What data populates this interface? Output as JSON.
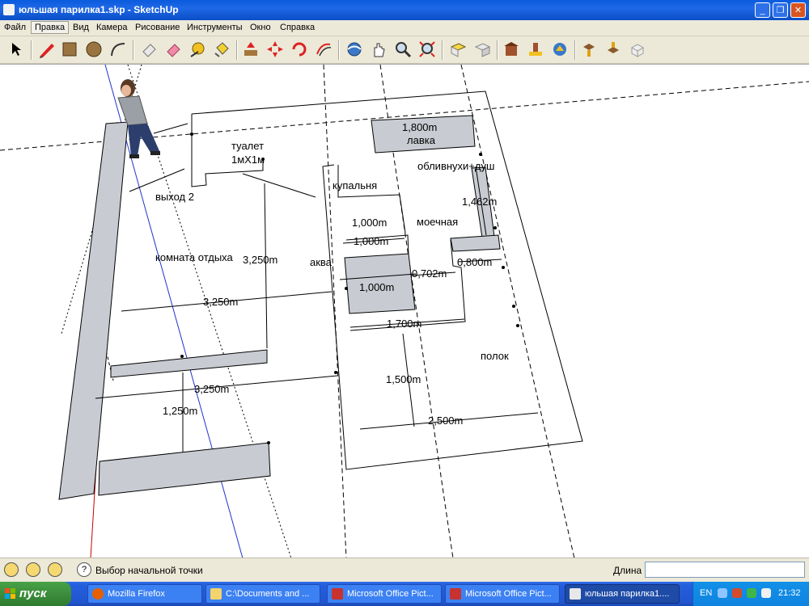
{
  "window": {
    "title": "юльшая парилка1.skp - SketchUp",
    "minimize_glyph": "_",
    "maximize_glyph": "❐",
    "close_glyph": "✕"
  },
  "menu": {
    "items": [
      "Файл",
      "Правка",
      "Вид",
      "Камера",
      "Рисование",
      "Инструменты",
      "Окно",
      "Справка"
    ],
    "active_index": 1
  },
  "toolbar": {
    "tools": [
      "select-icon",
      "pencil-icon",
      "rectangle-icon",
      "circle-icon",
      "arc-icon",
      "eraser-icon",
      "paint-eraser-icon",
      "tape-measure-icon",
      "paint-bucket-icon",
      "push-pull-icon",
      "move-icon",
      "rotate-icon",
      "offset-icon",
      "orbit-icon",
      "pan-icon",
      "zoom-icon",
      "zoom-extents-icon",
      "top-view-icon",
      "iso-view-icon",
      "warehouse-icon",
      "place-model-icon",
      "share-icon",
      "component-up-icon",
      "component-down-icon",
      "component-outline-icon"
    ]
  },
  "drawing": {
    "labels": {
      "toilet": "туалет",
      "toilet_size": "1мХ1м",
      "exit2": "выход 2",
      "rest_room": "комната отдыха",
      "bath": "купальня",
      "washroom": "моечная",
      "bench": "лавка",
      "douse": "обливнухи+душ",
      "aqua": "аква",
      "shelf": "полок"
    },
    "dimensions": {
      "d1800": "1,800m",
      "d1462": "1,462m",
      "d1000a": "1,000m",
      "d1000b": "1,000m",
      "d1000c": "1,000m",
      "d0702": "0,702m",
      "d0800": "0,800m",
      "d1700": "1,700m",
      "d1500": "1,500m",
      "d2500": "2,500m",
      "d3250a": "3,250m",
      "d3250b": "3,250m",
      "d3250c": "3,250m",
      "d1250": "1,250m"
    },
    "colors": {
      "face": "#c8ccd2",
      "edge": "#000000",
      "guide": "#000000",
      "axis_red": "#cc0000",
      "axis_blue": "#2233cc"
    }
  },
  "statusbar": {
    "icons": [
      "geo-icon",
      "credits-icon",
      "user-icon"
    ],
    "text": "Выбор начальной точки",
    "help_glyph": "?",
    "vcb_label": "Длина",
    "vcb_value": ""
  },
  "taskbar": {
    "start_label": "пуск",
    "tasks": [
      {
        "label": "Mozilla Firefox",
        "icon": "firefox-icon",
        "active": false
      },
      {
        "label": "C:\\Documents and ...",
        "icon": "folder-icon",
        "active": false
      },
      {
        "label": "Microsoft Office Pict...",
        "icon": "picture-manager-icon",
        "active": false
      },
      {
        "label": "Microsoft Office Pict...",
        "icon": "picture-manager-icon",
        "active": false
      },
      {
        "label": "юльшая парилка1....",
        "icon": "sketchup-icon",
        "active": true
      }
    ],
    "language": "EN",
    "clock": "21:32"
  }
}
